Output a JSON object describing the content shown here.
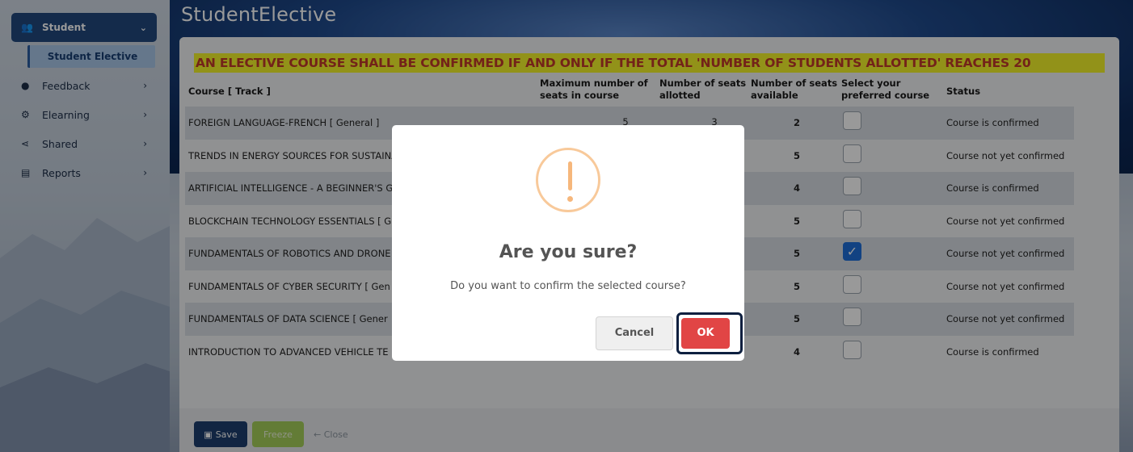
{
  "sidebar": {
    "parent": {
      "label": "Student"
    },
    "sub": {
      "label": "Student Elective"
    },
    "items": [
      {
        "label": "Feedback"
      },
      {
        "label": "Elearning"
      },
      {
        "label": "Shared"
      },
      {
        "label": "Reports"
      }
    ]
  },
  "page": {
    "title": "StudentElective",
    "banner": "AN ELECTIVE COURSE SHALL BE CONFIRMED IF AND ONLY IF THE TOTAL 'NUMBER OF STUDENTS ALLOTTED' REACHES 20"
  },
  "table": {
    "headers": {
      "course": "Course [ Track ]",
      "max_l1": "Maximum number of",
      "max_l2": "seats in course",
      "allot_l1": "Number of seats",
      "allot_l2": "allotted",
      "avail_l1": "Number of seats",
      "avail_l2": "available",
      "select_l1": "Select your",
      "select_l2": "preferred course",
      "status": "Status"
    },
    "rows": [
      {
        "course": "FOREIGN LANGUAGE-FRENCH [ General ]",
        "max": "5",
        "allot": "3",
        "avail": "2",
        "checked": false,
        "status": "Course is confirmed"
      },
      {
        "course": "TRENDS IN ENERGY SOURCES FOR SUSTAINA",
        "avail": "5",
        "checked": false,
        "status": "Course not yet confirmed"
      },
      {
        "course": "ARTIFICIAL INTELLIGENCE - A BEGINNER'S GU",
        "avail": "4",
        "checked": false,
        "status": "Course is confirmed"
      },
      {
        "course": "BLOCKCHAIN TECHNOLOGY ESSENTIALS [ G",
        "avail": "5",
        "checked": false,
        "status": "Course not yet confirmed"
      },
      {
        "course": "FUNDAMENTALS OF ROBOTICS AND DRONE",
        "avail": "5",
        "checked": true,
        "status": "Course not yet confirmed"
      },
      {
        "course": "FUNDAMENTALS OF CYBER SECURITY [ Gen",
        "avail": "5",
        "checked": false,
        "status": "Course not yet confirmed"
      },
      {
        "course": "FUNDAMENTALS OF DATA SCIENCE [ Gener",
        "avail": "5",
        "checked": false,
        "status": "Course not yet confirmed"
      },
      {
        "course": "INTRODUCTION TO ADVANCED VEHICLE TE",
        "avail": "4",
        "checked": false,
        "status": "Course is confirmed"
      }
    ]
  },
  "footer": {
    "save": "Save",
    "freeze": "Freeze",
    "close": "← Close"
  },
  "modal": {
    "title": "Are you sure?",
    "text": "Do you want to confirm the selected course?",
    "cancel": "Cancel",
    "ok": "OK"
  },
  "colors": {
    "banner_bg": "#f3f32a",
    "banner_text": "#c0392b",
    "ok_button": "#e14545",
    "save_button": "#1d3f6e",
    "freeze_button": "#a5cf5b",
    "sidebar_active": "#22497e",
    "warning": "#f6b77c"
  }
}
